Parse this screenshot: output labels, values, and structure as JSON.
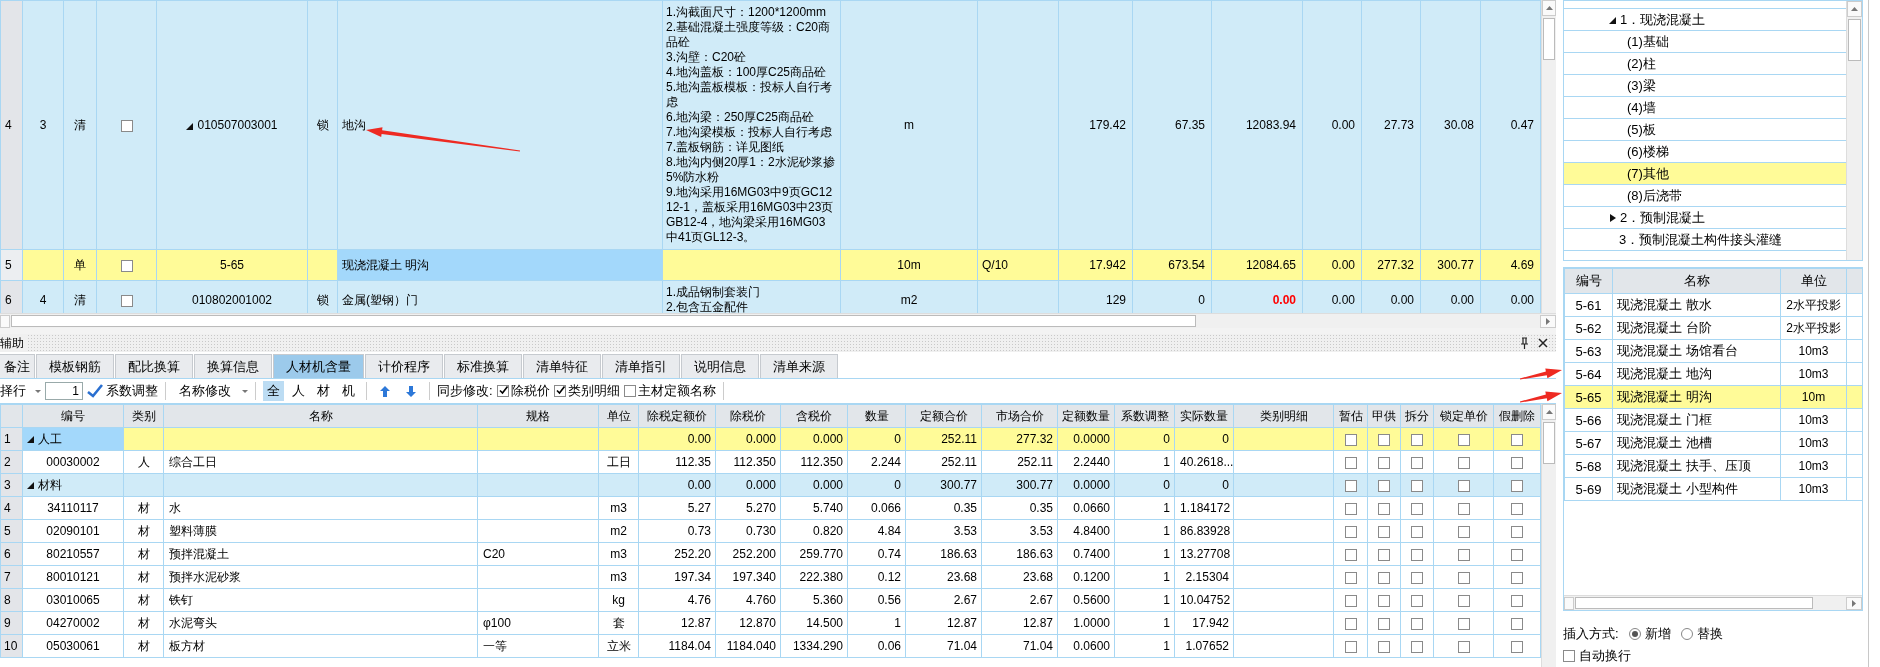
{
  "top_table": {
    "rows": [
      {
        "row_number": "4",
        "seq": "3",
        "type": "清",
        "kind": "bill",
        "selected": false,
        "checked": false,
        "expanded": true,
        "code": "010507003001",
        "lock": "锁",
        "name": "地沟",
        "features": "1.沟截面尺寸：1200*1200mm\n2.基础混凝土强度等级：C20商品砼\n3.沟壁：C20砼\n4.地沟盖板：100厚C25商品砼\n5.地沟盖板模板：投标人自行考虑\n6.地沟梁：250厚C25商品砼\n7.地沟梁模板：投标人自行考虑\n7.盖板钢筋：详见图纸\n8.地沟内侧20厚1：2水泥砂浆掺5%防水粉\n9.地沟采用16MG03中9页GC1212-1，盖板采用16MG03中23页GB12-4，地沟梁采用16MG03中41页GL12-3。",
        "unit": "m",
        "values": [
          "179.42",
          "67.35",
          "12083.94",
          "0.00",
          "27.73",
          "30.08",
          "0.47"
        ]
      },
      {
        "row_number": "5",
        "type": "单",
        "kind": "quota",
        "selected": true,
        "checked": false,
        "code": "5-65",
        "name": "现浇混凝土 明沟",
        "unit": "10m",
        "conversion": "Q/10",
        "values": [
          "17.942",
          "673.54",
          "12084.65",
          "0.00",
          "277.32",
          "300.77",
          "4.69"
        ]
      },
      {
        "row_number": "6",
        "seq": "4",
        "type": "清",
        "kind": "bill",
        "selected": false,
        "checked": false,
        "code": "010802001002",
        "lock": "锁",
        "name": "金属(塑钢）门",
        "features": "1.成品钢制套装门\n2.包含五金配件",
        "unit": "m2",
        "values": [
          "129",
          "0",
          {
            "text": "0.00",
            "color": "#ff0000"
          },
          "0.00",
          "0.00",
          "0.00",
          "0.00"
        ]
      }
    ]
  },
  "aux_panel": {
    "title": "辅助",
    "tabs": [
      {
        "label": "备注",
        "selected": false
      },
      {
        "label": "模板钢筋",
        "selected": false
      },
      {
        "label": "配比换算",
        "selected": false
      },
      {
        "label": "换算信息",
        "selected": false
      },
      {
        "label": "人材机含量",
        "selected": true
      },
      {
        "label": "计价程序",
        "selected": false
      },
      {
        "label": "标准换算",
        "selected": false
      },
      {
        "label": "清单特征",
        "selected": false
      },
      {
        "label": "清单指引",
        "selected": false
      },
      {
        "label": "说明信息",
        "selected": false
      },
      {
        "label": "清单来源",
        "selected": false
      }
    ],
    "toolbar": {
      "row_select": "择行",
      "count": "1",
      "coef_adjust": "系数调整",
      "name_edit": "名称修改",
      "filters": [
        {
          "label": "全",
          "selected": true
        },
        {
          "label": "人",
          "selected": false
        },
        {
          "label": "材",
          "selected": false
        },
        {
          "label": "机",
          "selected": false
        }
      ],
      "sync_label": "同步修改:",
      "sync_options": [
        {
          "label": "除税价",
          "checked": true
        },
        {
          "label": "类别明细",
          "checked": true
        },
        {
          "label": "主材定额名称",
          "checked": false
        }
      ]
    },
    "table": {
      "columns": [
        "编号",
        "类别",
        "名称",
        "规格",
        "单位",
        "除税定额价",
        "除税价",
        "含税价",
        "数量",
        "定额合价",
        "市场合价",
        "定额数量",
        "系数调整",
        "实际数量",
        "类别明细",
        "暂估",
        "甲供",
        "拆分",
        "锁定单价",
        "假删除"
      ],
      "rows": [
        {
          "row_number": "1",
          "kind": "group",
          "selected": true,
          "expanded": true,
          "code": "人工",
          "base_price": "0.00",
          "price": "0.000",
          "tax_price": "0.000",
          "qty": "0",
          "quota_total": "252.11",
          "market_total": "277.32",
          "quota_qty": "0.0000",
          "coef": "0",
          "actual_qty": "0",
          "flags": [
            false,
            false,
            false,
            false,
            false
          ]
        },
        {
          "row_number": "2",
          "kind": "item",
          "selected": false,
          "code": "00030002",
          "category": "人",
          "name": "综合工日",
          "unit": "工日",
          "base_price": "112.35",
          "price": "112.350",
          "tax_price": "112.350",
          "qty": "2.244",
          "quota_total": "252.11",
          "market_total": "252.11",
          "quota_qty": "2.2440",
          "coef": "1",
          "actual_qty": "40.2618...",
          "flags": [
            false,
            false,
            false,
            false,
            false
          ]
        },
        {
          "row_number": "3",
          "kind": "group",
          "selected": false,
          "expanded": true,
          "code": "材料",
          "base_price": "0.00",
          "price": "0.000",
          "tax_price": "0.000",
          "qty": "0",
          "quota_total": "300.77",
          "market_total": "300.77",
          "quota_qty": "0.0000",
          "coef": "0",
          "actual_qty": "0",
          "flags": [
            false,
            false,
            false,
            false,
            false
          ]
        },
        {
          "row_number": "4",
          "kind": "item",
          "selected": false,
          "code": "34110117",
          "category": "材",
          "name": "水",
          "unit": "m3",
          "base_price": "5.27",
          "price": "5.270",
          "tax_price": "5.740",
          "qty": "0.066",
          "quota_total": "0.35",
          "market_total": "0.35",
          "quota_qty": "0.0660",
          "coef": "1",
          "actual_qty": "1.184172",
          "flags": [
            false,
            false,
            false,
            false,
            false
          ]
        },
        {
          "row_number": "5",
          "kind": "item",
          "selected": false,
          "code": "02090101",
          "category": "材",
          "name": "塑料薄膜",
          "unit": "m2",
          "base_price": "0.73",
          "price": "0.730",
          "tax_price": "0.820",
          "qty": "4.84",
          "quota_total": "3.53",
          "market_total": "3.53",
          "quota_qty": "4.8400",
          "coef": "1",
          "actual_qty": "86.83928",
          "flags": [
            false,
            false,
            false,
            false,
            false
          ]
        },
        {
          "row_number": "6",
          "kind": "item",
          "selected": false,
          "code": "80210557",
          "category": "材",
          "name": "预拌混凝土",
          "spec": "C20",
          "unit": "m3",
          "base_price": "252.20",
          "price": "252.200",
          "tax_price": "259.770",
          "qty": "0.74",
          "quota_total": "186.63",
          "market_total": "186.63",
          "quota_qty": "0.7400",
          "coef": "1",
          "actual_qty": "13.27708",
          "flags": [
            false,
            false,
            false,
            false,
            false
          ]
        },
        {
          "row_number": "7",
          "kind": "item",
          "selected": false,
          "code": "80010121",
          "category": "材",
          "name": "预拌水泥砂浆",
          "unit": "m3",
          "base_price": "197.34",
          "price": "197.340",
          "tax_price": "222.380",
          "qty": "0.12",
          "quota_total": "23.68",
          "market_total": "23.68",
          "quota_qty": "0.1200",
          "coef": "1",
          "actual_qty": "2.15304",
          "flags": [
            false,
            false,
            false,
            false,
            false
          ]
        },
        {
          "row_number": "8",
          "kind": "item",
          "selected": false,
          "code": "03010065",
          "category": "材",
          "name": "铁钉",
          "unit": "kg",
          "base_price": "4.76",
          "price": "4.760",
          "tax_price": "5.360",
          "qty": "0.56",
          "quota_total": "2.67",
          "market_total": "2.67",
          "quota_qty": "0.5600",
          "coef": "1",
          "actual_qty": "10.04752",
          "flags": [
            false,
            false,
            false,
            false,
            false
          ]
        },
        {
          "row_number": "9",
          "kind": "item",
          "selected": false,
          "code": "04270002",
          "category": "材",
          "name": "水泥弯头",
          "spec": "φ100",
          "unit": "套",
          "base_price": "12.87",
          "price": "12.870",
          "tax_price": "14.500",
          "qty": "1",
          "quota_total": "12.87",
          "market_total": "12.87",
          "quota_qty": "1.0000",
          "coef": "1",
          "actual_qty": "17.942",
          "flags": [
            false,
            false,
            false,
            false,
            false
          ]
        },
        {
          "row_number": "10",
          "kind": "item",
          "selected": false,
          "code": "05030061",
          "category": "材",
          "name": "板方材",
          "spec": "一等",
          "unit": "立米",
          "base_price": "1184.04",
          "price": "1184.040",
          "tax_price": "1334.290",
          "qty": "0.06",
          "quota_total": "71.04",
          "market_total": "71.04",
          "quota_qty": "0.0600",
          "coef": "1",
          "actual_qty": "1.07652",
          "flags": [
            false,
            false,
            false,
            false,
            false
          ]
        }
      ]
    }
  },
  "side_panel": {
    "tree": [
      {
        "label": "1．现浇混凝土",
        "selected": false,
        "expanded": true,
        "children": [
          {
            "label": "(1)基础",
            "selected": false
          },
          {
            "label": "(2)柱",
            "selected": false
          },
          {
            "label": "(3)梁",
            "selected": false
          },
          {
            "label": "(4)墙",
            "selected": false
          },
          {
            "label": "(5)板",
            "selected": false
          },
          {
            "label": "(6)楼梯",
            "selected": false
          },
          {
            "label": "(7)其他",
            "selected": true
          },
          {
            "label": "(8)后浇带",
            "selected": false
          }
        ]
      },
      {
        "label": "2．预制混凝土",
        "selected": false,
        "expanded": false
      },
      {
        "label": "3．预制混凝土构件接头灌缝",
        "selected": false
      }
    ],
    "list": {
      "columns": [
        "编号",
        "名称",
        "单位"
      ],
      "rows": [
        {
          "code": "5-61",
          "name": "现浇混凝土 散水",
          "unit": "2水平投影",
          "selected": false
        },
        {
          "code": "5-62",
          "name": "现浇混凝土 台阶",
          "unit": "2水平投影",
          "selected": false
        },
        {
          "code": "5-63",
          "name": "现浇混凝土 场馆看台",
          "unit": "10m3",
          "selected": false
        },
        {
          "code": "5-64",
          "name": "现浇混凝土 地沟",
          "unit": "10m3",
          "selected": false
        },
        {
          "code": "5-65",
          "name": "现浇混凝土 明沟",
          "unit": "10m",
          "selected": true
        },
        {
          "code": "5-66",
          "name": "现浇混凝土 门框",
          "unit": "10m3",
          "selected": false
        },
        {
          "code": "5-67",
          "name": "现浇混凝土 池槽",
          "unit": "10m3",
          "selected": false
        },
        {
          "code": "5-68",
          "name": "现浇混凝土 扶手、压顶",
          "unit": "10m3",
          "selected": false
        },
        {
          "code": "5-69",
          "name": "现浇混凝土 小型构件",
          "unit": "10m3",
          "selected": false
        }
      ]
    },
    "insert_mode": {
      "label": "插入方式:",
      "options": [
        {
          "label": "新增",
          "selected": true
        },
        {
          "label": "替换",
          "selected": false
        }
      ]
    },
    "auto_wrap": {
      "label": "自动换行",
      "checked": false
    }
  }
}
